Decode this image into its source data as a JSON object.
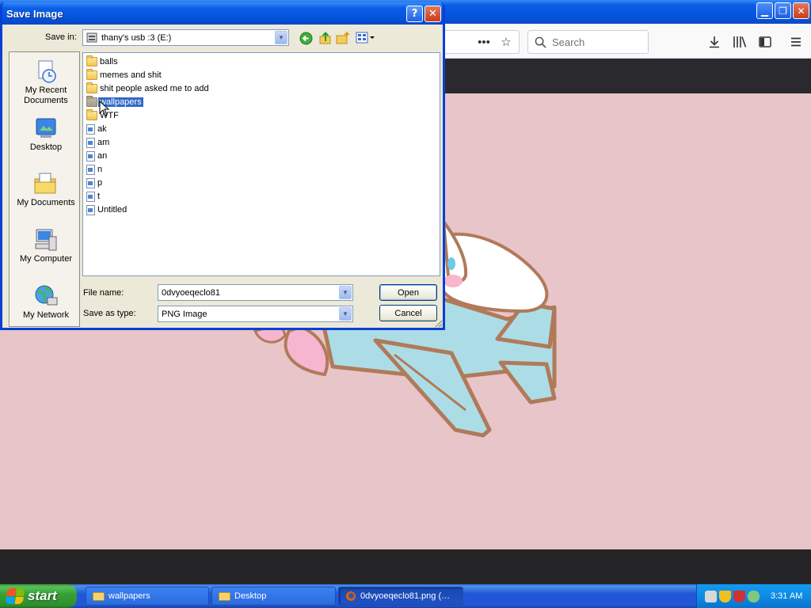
{
  "browser": {
    "search_placeholder": "Search",
    "toolbar_icons": [
      "more-icon",
      "bookmark-star-icon",
      "downloads-icon",
      "library-icon",
      "sidebar-icon",
      "menu-icon"
    ]
  },
  "dialog": {
    "title": "Save Image",
    "save_in_label": "Save in:",
    "save_in_value": "thany's usb :3 (E:)",
    "places": [
      {
        "label_line1": "My Recent",
        "label_line2": "Documents",
        "icon": "recent-documents-icon"
      },
      {
        "label_line1": "Desktop",
        "label_line2": "",
        "icon": "desktop-icon"
      },
      {
        "label_line1": "My Documents",
        "label_line2": "",
        "icon": "my-documents-icon"
      },
      {
        "label_line1": "My Computer",
        "label_line2": "",
        "icon": "my-computer-icon"
      },
      {
        "label_line1": "My Network",
        "label_line2": "",
        "icon": "my-network-icon"
      }
    ],
    "files": [
      {
        "name": "balls",
        "type": "folder"
      },
      {
        "name": "memes and shit",
        "type": "folder"
      },
      {
        "name": "shit people asked me to add",
        "type": "folder"
      },
      {
        "name": "wallpapers",
        "type": "folder",
        "selected": true
      },
      {
        "name": "WTF",
        "type": "folder"
      },
      {
        "name": "ak",
        "type": "image"
      },
      {
        "name": "am",
        "type": "image"
      },
      {
        "name": "an",
        "type": "image"
      },
      {
        "name": "n",
        "type": "image"
      },
      {
        "name": "p",
        "type": "image"
      },
      {
        "name": "t",
        "type": "image"
      },
      {
        "name": "Untitled",
        "type": "image"
      }
    ],
    "file_name_label": "File name:",
    "file_name_value": "0dvyoeqeclo81",
    "save_as_type_label": "Save as type:",
    "save_as_type_value": "PNG Image",
    "open_button": "Open",
    "cancel_button": "Cancel"
  },
  "taskbar": {
    "start_label": "start",
    "tasks": [
      {
        "label": "wallpapers",
        "icon": "folder-icon"
      },
      {
        "label": "Desktop",
        "icon": "folder-icon"
      },
      {
        "label": "0dvyoeqeclo81.png (…",
        "icon": "firefox-icon"
      }
    ],
    "clock": "3:31 AM"
  },
  "colors": {
    "xp_blue": "#0453db",
    "dialog_bg": "#ece9d8",
    "selection": "#316ac5",
    "wallpaper_pink": "#e7c5c8",
    "start_green": "#37a137"
  }
}
